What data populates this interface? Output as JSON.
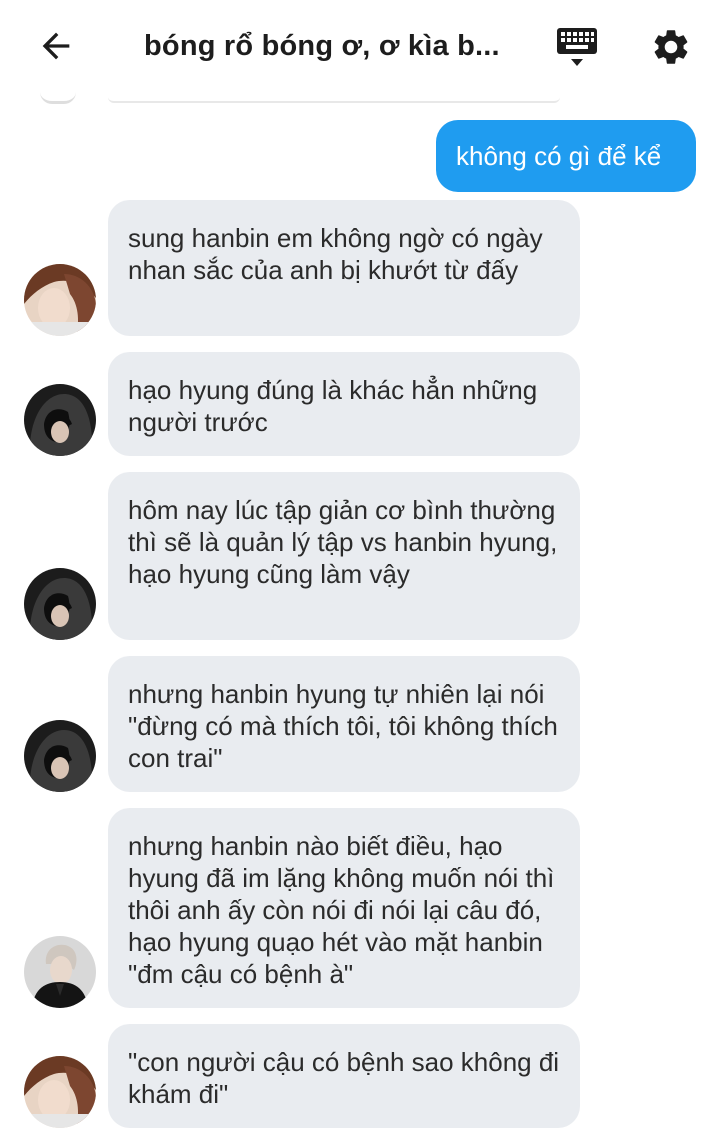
{
  "header": {
    "title": "bóng rổ bóng ơ, ơ kìa b...",
    "back_icon": "arrow-left-icon",
    "keyboard_icon": "keyboard-icon",
    "settings_icon": "gear-icon"
  },
  "colors": {
    "outgoing_bubble": "#1f9cf0",
    "incoming_bubble": "#e9ecf0",
    "text": "#2b2b2b"
  },
  "messages": [
    {
      "direction": "outgoing",
      "text": "không có gì để kể"
    },
    {
      "direction": "incoming",
      "avatar": "avatar-brown-hair",
      "text": "sung hanbin em không ngờ có ngày nhan sắc của anh bị khướt từ đấy"
    },
    {
      "direction": "incoming",
      "avatar": "avatar-hooded",
      "text": "hạo hyung đúng là khác hẳn những người trước"
    },
    {
      "direction": "incoming",
      "avatar": "avatar-hooded",
      "text": "hôm nay lúc tập giản cơ bình thường thì sẽ là quản lý tập vs hanbin hyung, hạo hyung cũng làm vậy"
    },
    {
      "direction": "incoming",
      "avatar": "avatar-hooded",
      "text": "nhưng hanbin hyung tự nhiên lại nói \"đừng có mà thích tôi, tôi không thích con trai\""
    },
    {
      "direction": "incoming",
      "avatar": "avatar-light-hair",
      "text": "nhưng hanbin nào biết điều, hạo hyung đã im lặng không muốn nói thì thôi anh ấy còn nói đi nói lại câu đó, hạo hyung quạo hét vào mặt hanbin \"đm cậu có bệnh à\""
    },
    {
      "direction": "incoming",
      "avatar": "avatar-brown-hair",
      "text": "\"con người cậu có bệnh sao không đi khám đi\""
    }
  ]
}
